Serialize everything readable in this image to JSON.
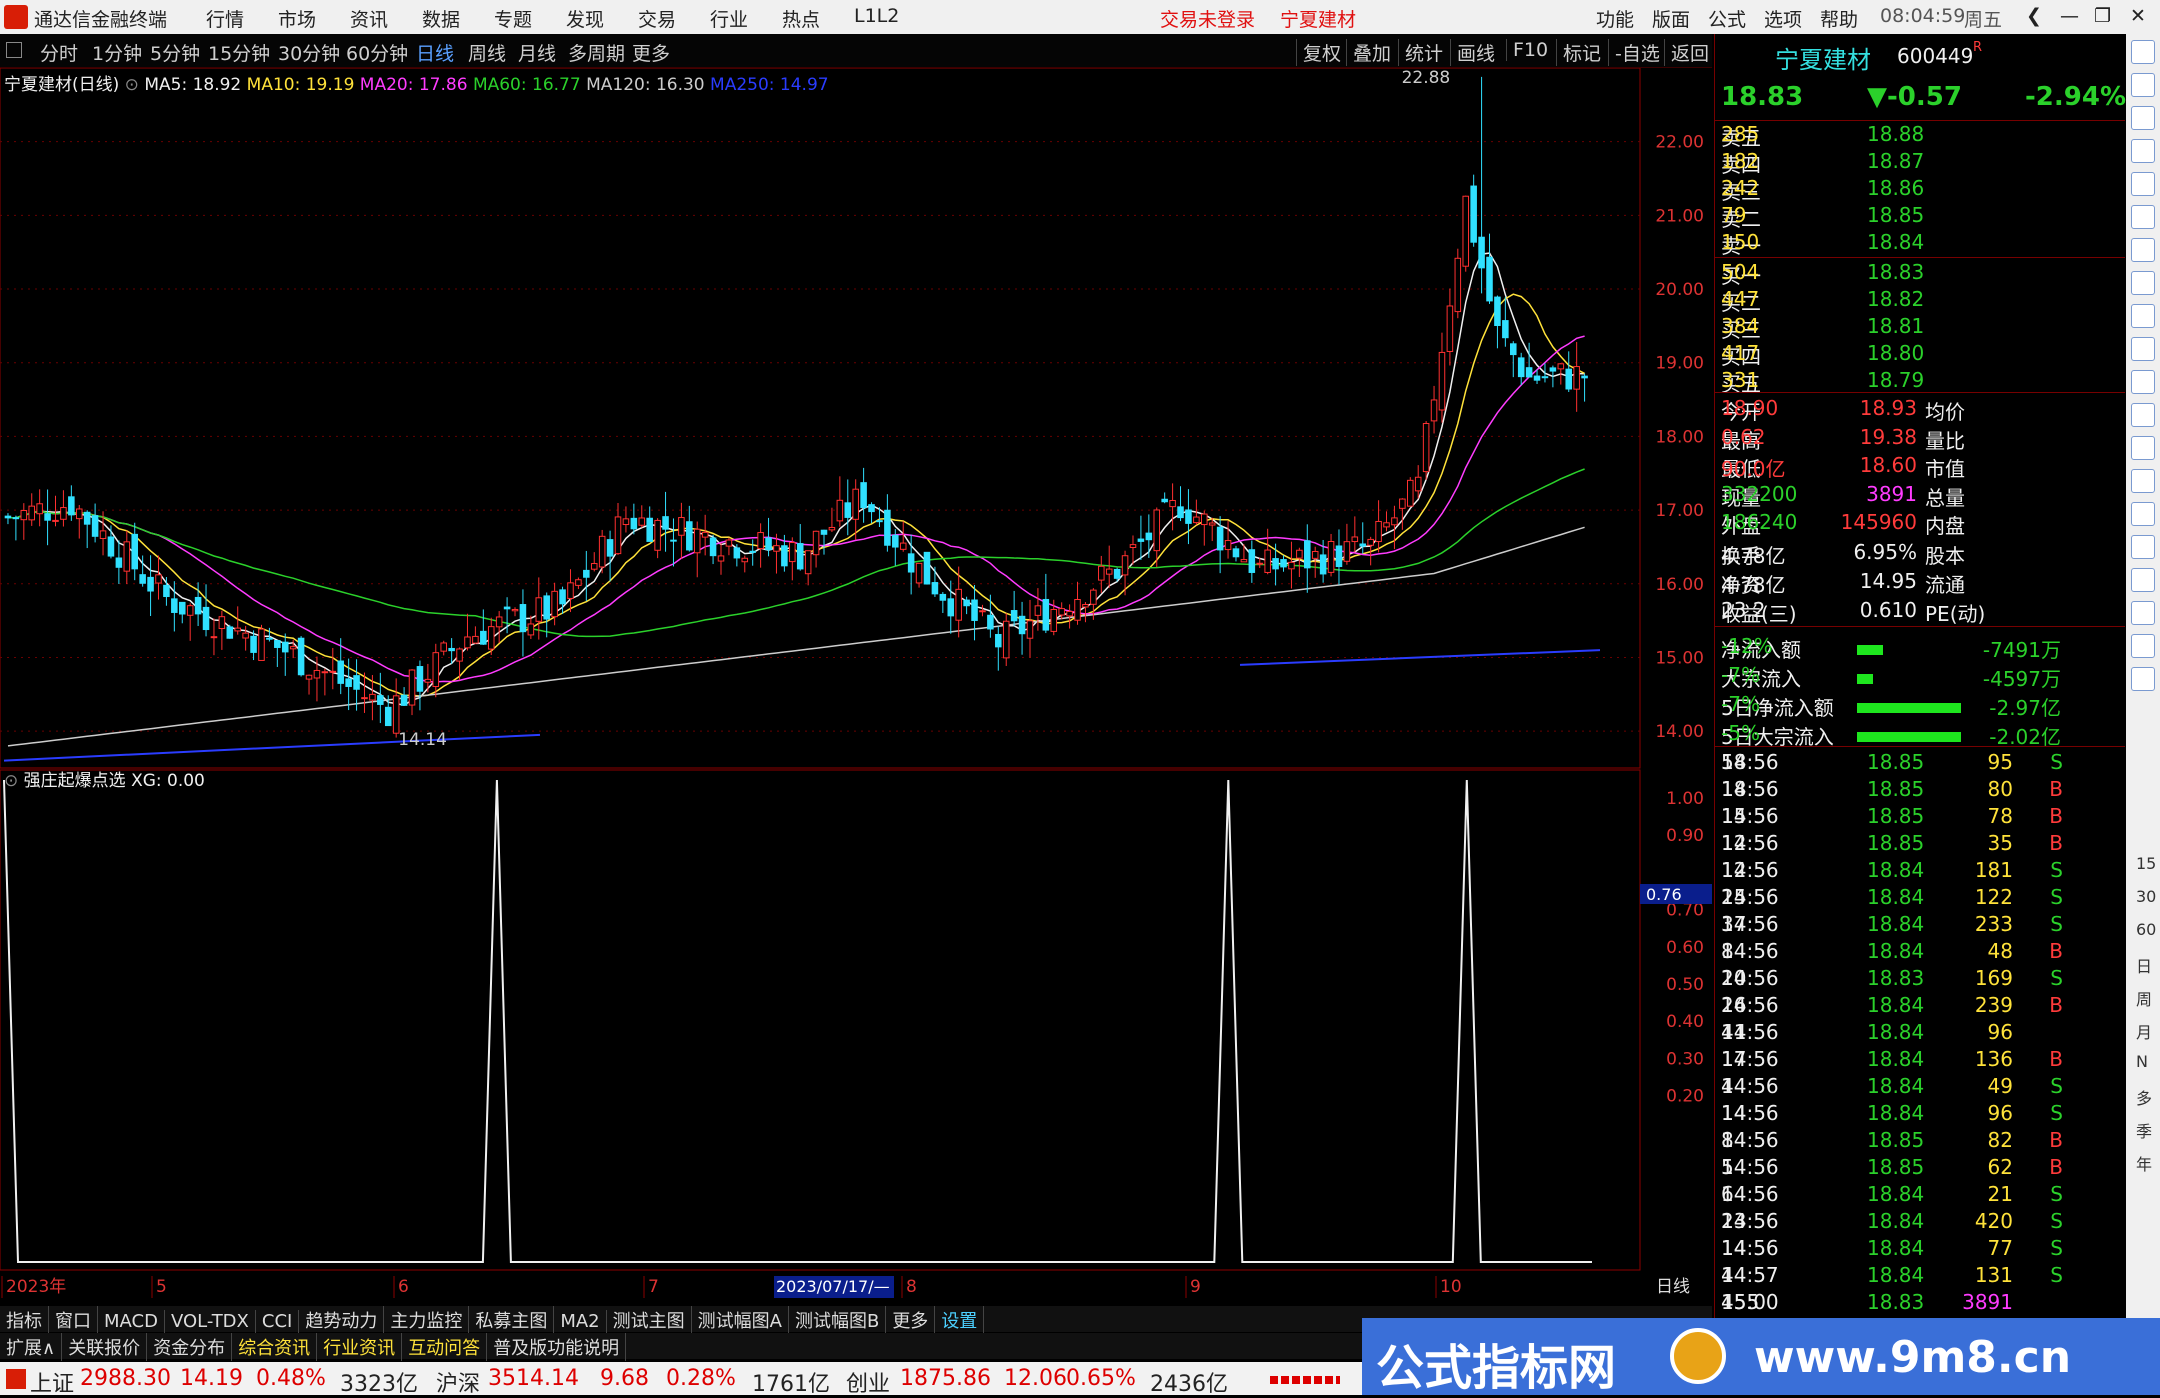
{
  "menubar": {
    "app_title": "通达信金融终端",
    "items": [
      "行情",
      "市场",
      "资讯",
      "数据",
      "专题",
      "发现",
      "交易",
      "行业",
      "热点",
      "L1L2"
    ],
    "login": "交易未登录",
    "stock": "宁夏建材",
    "right": [
      "功能",
      "版面",
      "公式",
      "选项",
      "帮助"
    ],
    "time": "08:04:59",
    "weekday": "周五"
  },
  "periods": {
    "items": [
      "分时",
      "1分钟",
      "5分钟",
      "15分钟",
      "30分钟",
      "60分钟",
      "日线",
      "周线",
      "月线",
      "多周期",
      "更多"
    ],
    "active": "日线",
    "right": [
      "复权",
      "叠加",
      "统计",
      "画线",
      "F10",
      "标记",
      "-自选",
      "返回"
    ]
  },
  "legend_main": {
    "name": "宁夏建材(日线)",
    "ma5": "MA5: 18.92",
    "ma10": "MA10: 19.19",
    "ma20": "MA20: 17.86",
    "ma60": "MA60: 16.77",
    "ma120": "MA120: 16.30",
    "ma250": "MA250: 14.97"
  },
  "legend_sub": {
    "name": "强庄起爆点选",
    "xg": "XG: 0.00"
  },
  "price_axis": [
    "22.00",
    "21.00",
    "20.00",
    "19.00",
    "18.00",
    "17.00",
    "16.00",
    "15.00",
    "14.00"
  ],
  "sub_axis": [
    "1.00",
    "0.90",
    "0.70",
    "0.60",
    "0.50",
    "0.40",
    "0.30",
    "0.20"
  ],
  "sub_marker": "0.76",
  "annot": {
    "high": "22.88",
    "low": "14.14"
  },
  "xaxis": {
    "labels": [
      "2023年",
      "5",
      "6",
      "7",
      "8",
      "9",
      "10"
    ],
    "cursor": "2023/07/17/—",
    "right_tab": "日线"
  },
  "chart_data": {
    "type": "candlestick",
    "xg_signal_days": [
      0.0,
      0.31,
      0.77,
      0.92
    ],
    "price_range": [
      13.5,
      23.0
    ],
    "high": 22.88,
    "low": 14.14
  },
  "quote": {
    "name": "宁夏建材",
    "code": "600449",
    "price": "18.83",
    "change": "▼-0.57",
    "pct": "-2.94%",
    "asks": [
      [
        "卖五",
        "18.88",
        "285"
      ],
      [
        "卖四",
        "18.87",
        "182"
      ],
      [
        "卖三",
        "18.86",
        "242"
      ],
      [
        "卖二",
        "18.85",
        "79"
      ],
      [
        "卖一",
        "18.84",
        "150"
      ]
    ],
    "bids": [
      [
        "买一",
        "18.83",
        "504"
      ],
      [
        "买二",
        "18.82",
        "447"
      ],
      [
        "买三",
        "18.81",
        "384"
      ],
      [
        "买四",
        "18.80",
        "417"
      ],
      [
        "买五",
        "18.79",
        "331"
      ]
    ],
    "stats": [
      [
        "今开",
        "18.93",
        "均价",
        "18.90"
      ],
      [
        "最高",
        "19.38",
        "量比",
        "0.62"
      ],
      [
        "最低",
        "18.60",
        "市值",
        "90.0亿"
      ],
      [
        "现量",
        "3891",
        "总量",
        "332200"
      ],
      [
        "外盘",
        "145960",
        "内盘",
        "186240"
      ],
      [
        "换手",
        "6.95%",
        "股本",
        "4.78亿"
      ],
      [
        "净资",
        "14.95",
        "流通",
        "4.78亿"
      ],
      [
        "收益(三)",
        "0.610",
        "PE(动)",
        "23.2"
      ]
    ],
    "flows": [
      [
        "净流入额",
        "-7491万",
        "-12%"
      ],
      [
        "大宗流入",
        "-4597万",
        "-7%"
      ],
      [
        "5日净流入额",
        "-2.97亿",
        "-7%"
      ],
      [
        "5日大宗流入",
        "-2.02亿",
        "-5%"
      ]
    ],
    "ticks": [
      [
        "14:56",
        "18.85",
        "95",
        "S",
        "58"
      ],
      [
        "14:56",
        "18.85",
        "80",
        "B",
        "18"
      ],
      [
        "14:56",
        "18.85",
        "78",
        "B",
        "15"
      ],
      [
        "14:56",
        "18.85",
        "35",
        "B",
        "12"
      ],
      [
        "14:56",
        "18.84",
        "181",
        "S",
        "12"
      ],
      [
        "14:56",
        "18.84",
        "122",
        "S",
        "25"
      ],
      [
        "14:56",
        "18.84",
        "233",
        "S",
        "37"
      ],
      [
        "14:56",
        "18.84",
        "48",
        "B",
        "8"
      ],
      [
        "14:56",
        "18.83",
        "169",
        "S",
        "20"
      ],
      [
        "14:56",
        "18.84",
        "239",
        "B",
        "26"
      ],
      [
        "14:56",
        "18.84",
        "96",
        "",
        "41"
      ],
      [
        "14:56",
        "18.84",
        "136",
        "B",
        "17"
      ],
      [
        "14:56",
        "18.84",
        "49",
        "S",
        "4"
      ],
      [
        "14:56",
        "18.84",
        "96",
        "S",
        "14"
      ],
      [
        "14:56",
        "18.85",
        "82",
        "B",
        "8"
      ],
      [
        "14:56",
        "18.85",
        "62",
        "B",
        "5"
      ],
      [
        "14:56",
        "18.84",
        "21",
        "S",
        "6"
      ],
      [
        "14:56",
        "18.84",
        "420",
        "S",
        "23"
      ],
      [
        "14:56",
        "18.84",
        "77",
        "S",
        "14"
      ],
      [
        "14:57",
        "18.84",
        "131",
        "S",
        "4"
      ],
      [
        "15:00",
        "18.83",
        "3891",
        "",
        "455"
      ]
    ]
  },
  "tabs1": [
    "指标",
    "窗口",
    "MACD",
    "VOL-TDX",
    "CCI",
    "趋势动力",
    "主力监控",
    "私募主图",
    "MA2",
    "测试主图",
    "测试幅图A",
    "测试幅图B",
    "更多",
    "设置"
  ],
  "tabs2": [
    "扩展∧",
    "关联报价",
    "资金分布",
    "综合资讯",
    "行业资讯",
    "互动问答",
    "普及版功能说明"
  ],
  "status": {
    "sh_name": "上证",
    "sh": "2988.30",
    "sh_chg": "14.19",
    "sh_pct": "0.48%",
    "sh_amt": "3323亿",
    "hs_name": "沪深",
    "hs": "3514.14",
    "hs_chg": "9.68",
    "hs_pct": "0.28%",
    "hs_amt": "1761亿",
    "cy_name": "创业",
    "cy": "1875.86",
    "cy_chg": "12.06",
    "cy_pct": "0.65%",
    "cy_amt": "2436亿"
  },
  "watermark": {
    "text": "公式指标网",
    "url": "www.9m8.cn"
  },
  "rtool": {
    "labels": [
      "15",
      "30",
      "60",
      "日",
      "周",
      "月",
      "N",
      "多",
      "季",
      "年"
    ]
  }
}
